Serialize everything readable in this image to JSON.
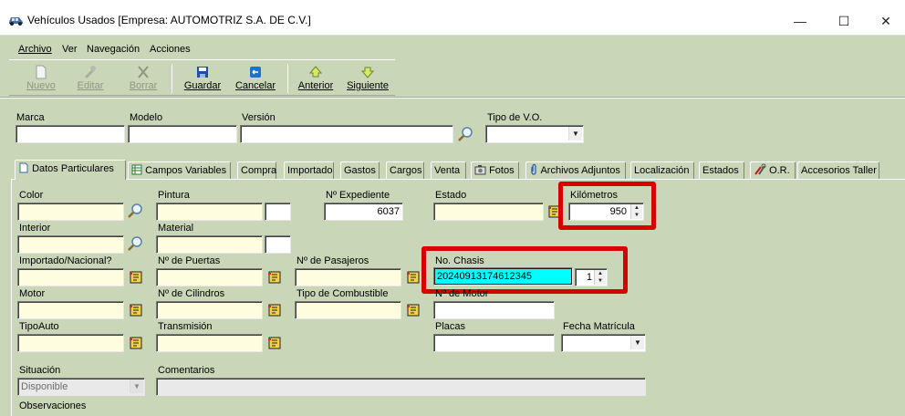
{
  "window": {
    "title": "Vehículos Usados [Empresa: AUTOMOTRIZ S.A. DE C.V.]",
    "minimize_glyph": "—",
    "maximize_glyph": "☐",
    "close_glyph": "✕"
  },
  "menu": [
    "Archivo",
    "Ver",
    "Navegación",
    "Acciones"
  ],
  "toolbar": {
    "nuevo": "Nuevo",
    "editar": "Editar",
    "borrar": "Borrar",
    "guardar": "Guardar",
    "cancelar": "Cancelar",
    "anterior": "Anterior",
    "siguiente": "Siguiente"
  },
  "header": {
    "marca_label": "Marca",
    "modelo_label": "Modelo",
    "version_label": "Versión",
    "tipo_vo_label": "Tipo de V.O.",
    "marca_value": "",
    "modelo_value": "",
    "version_value": "",
    "tipo_vo_value": ""
  },
  "tabs": [
    "Datos Particulares",
    "Campos Variables",
    "Compra",
    "Importado",
    "Gastos",
    "Cargos",
    "Venta",
    "Fotos",
    "Archivos Adjuntos",
    "Localización",
    "Estados",
    "O.R.",
    "Accesorios Taller"
  ],
  "form": {
    "color_label": "Color",
    "pintura_label": "Pintura",
    "expediente_label": "Nº Expediente",
    "expediente_value": "6037",
    "estado_label": "Estado",
    "kilometros_label": "Kilómetros",
    "kilometros_value": "950",
    "interior_label": "Interior",
    "material_label": "Material",
    "importado_label": "Importado/Nacional?",
    "puertas_label": "Nº de Puertas",
    "pasajeros_label": "Nº de Pasajeros",
    "chasis_label": "No. Chasis",
    "chasis_value": "20240913174612345",
    "chasis_count": "1",
    "motor_label": "Motor",
    "cilindros_label": "Nº de Cilindros",
    "combustible_label": "Tipo de Combustible",
    "no_motor_label": "Nº de Motor",
    "tipoauto_label": "TipoAuto",
    "transmision_label": "Transmisión",
    "placas_label": "Placas",
    "fecha_matricula_label": "Fecha Matrícula",
    "situacion_label": "Situación",
    "situacion_value": "Disponible",
    "comentarios_label": "Comentarios",
    "observaciones_label": "Observaciones"
  },
  "colors": {
    "background": "#c9d6b8",
    "highlight_red": "#d90000",
    "chasis_field": "#00ffff",
    "yellow_field": "#fffde0"
  }
}
